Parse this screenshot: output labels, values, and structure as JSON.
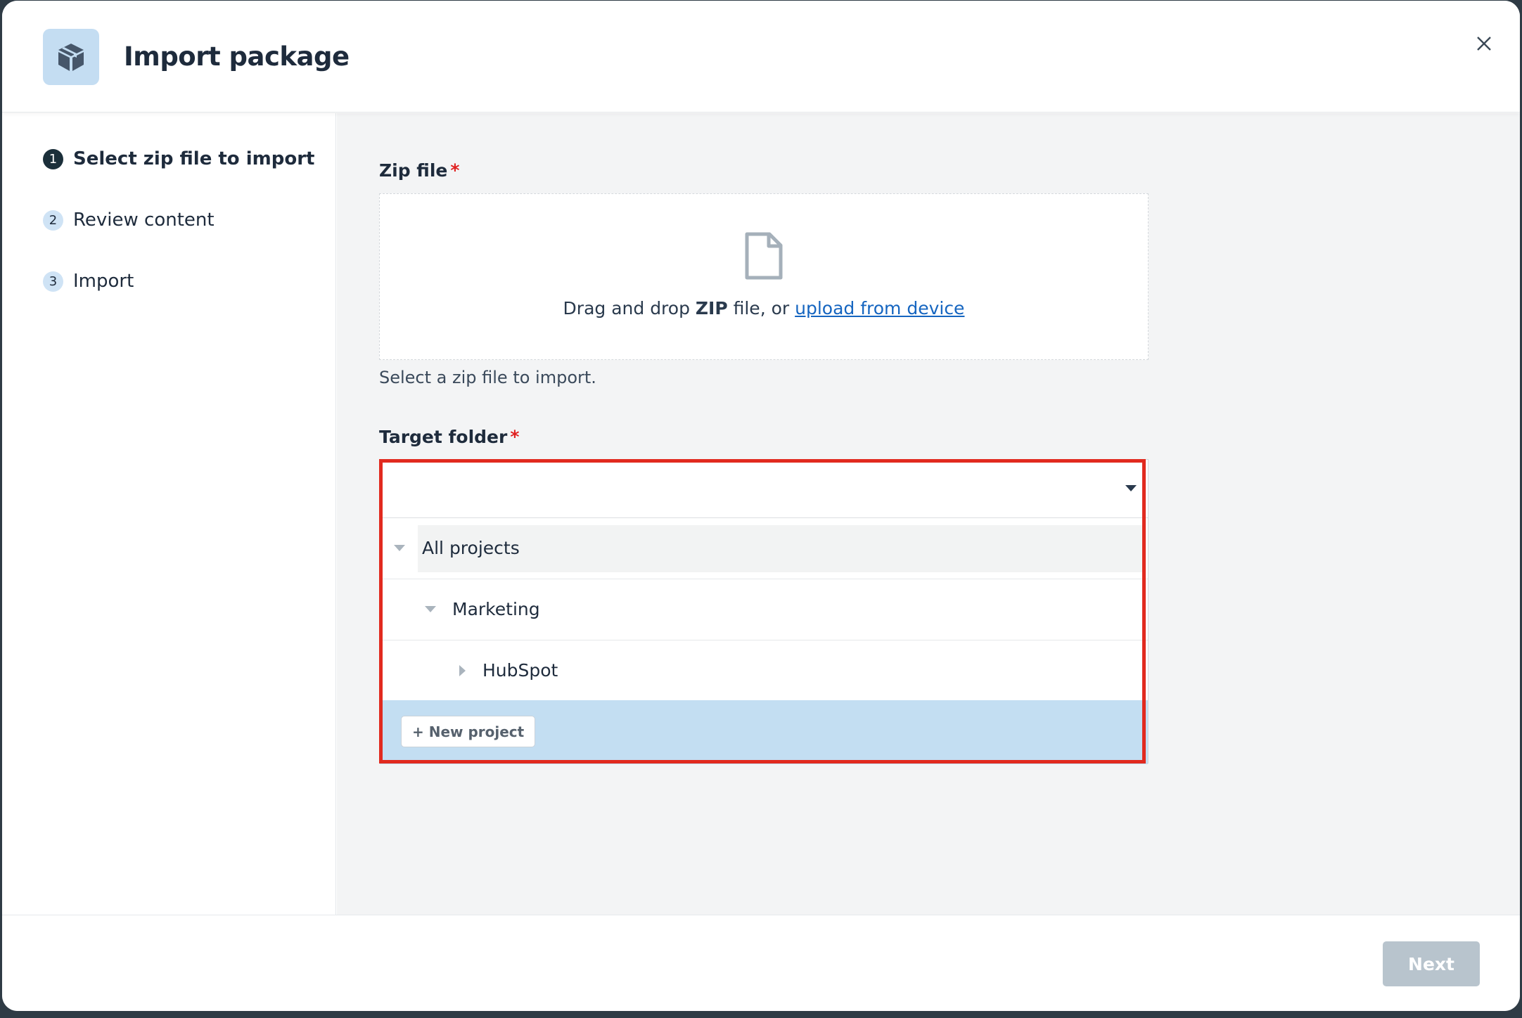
{
  "dialog": {
    "title": "Import package",
    "icon": "package-icon",
    "close_icon": "close-icon"
  },
  "steps": [
    {
      "number": "1",
      "label": "Select zip file to import",
      "active": true
    },
    {
      "number": "2",
      "label": "Review content",
      "active": false
    },
    {
      "number": "3",
      "label": "Import",
      "active": false
    }
  ],
  "zip_field": {
    "label": "Zip file",
    "required_mark": "*",
    "drop_text_prefix": "Drag and drop ",
    "drop_text_bold": "ZIP",
    "drop_text_middle": " file, or ",
    "upload_link": "upload from device",
    "hint": "Select a zip file to import.",
    "icon": "file-icon"
  },
  "target_folder": {
    "label": "Target folder",
    "required_mark": "*",
    "value": "",
    "tree": [
      {
        "label": "All projects",
        "expanded": true,
        "level": 0
      },
      {
        "label": "Marketing",
        "expanded": true,
        "level": 1
      },
      {
        "label": "HubSpot",
        "expanded": false,
        "level": 2
      }
    ],
    "new_project_label": "+ New project"
  },
  "footer": {
    "next_label": "Next"
  },
  "colors": {
    "accent_blue": "#c3def2",
    "highlight_red": "#e12a1f",
    "link": "#1565c0"
  }
}
